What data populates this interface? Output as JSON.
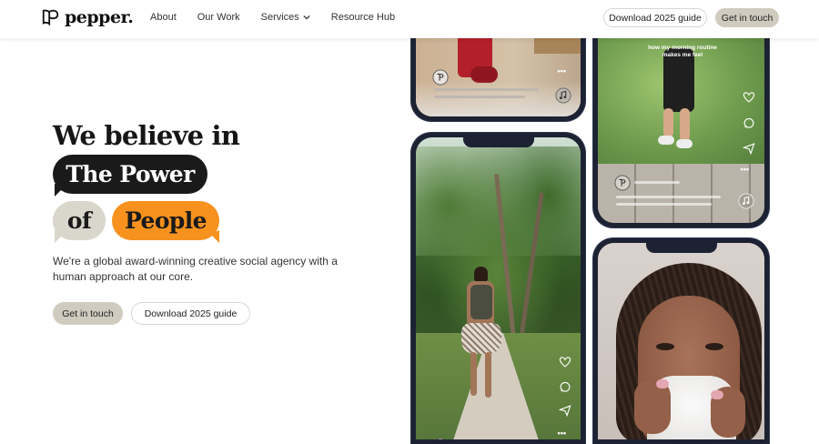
{
  "nav": {
    "logo_text": "pepper.",
    "links": [
      {
        "label": "About"
      },
      {
        "label": "Our Work"
      },
      {
        "label": "Services"
      },
      {
        "label": "Resource Hub"
      }
    ],
    "download_label": "Download 2025 guide",
    "contact_label": "Get in touch"
  },
  "hero": {
    "line1": "We believe in",
    "bubble1": "The Power",
    "bubble2": "of",
    "bubble3": "People",
    "description": "We're a global award-winning creative social agency with a human approach at our core.",
    "primary_button": "Get in touch",
    "secondary_button": "Download 2025 guide"
  },
  "phones": {
    "top_right_caption": "how my morning routine makes me feel"
  },
  "colors": {
    "accent_orange": "#f7921e",
    "accent_beige": "#cfcbbf",
    "dark": "#1a1a1a",
    "phone_frame": "#1d2233"
  },
  "icons": [
    "logo-mark-icon",
    "chevron-down-icon",
    "heart-icon",
    "comment-icon",
    "share-icon",
    "music-icon"
  ]
}
